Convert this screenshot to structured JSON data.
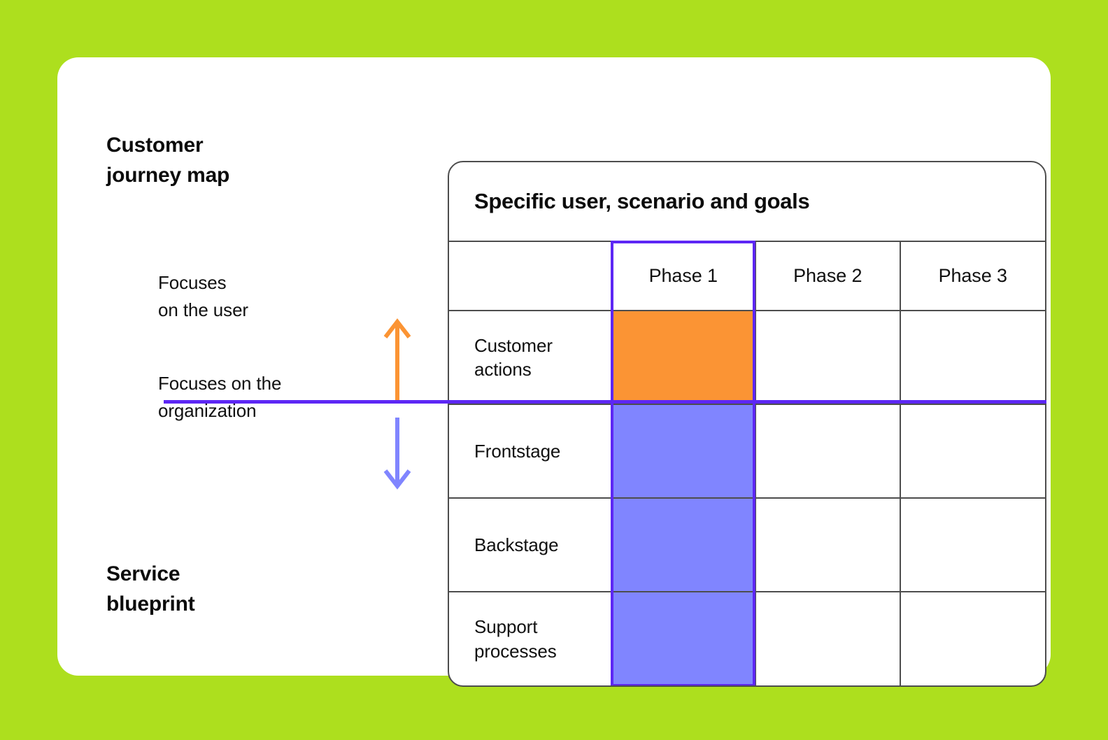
{
  "theme": {
    "background_green": "#ADDF1E",
    "card_white": "#FFFFFF",
    "accent_purple": "#5D27F5",
    "fill_purple": "#8085FF",
    "fill_orange": "#FB9434",
    "grid_gray": "#4D4D4D"
  },
  "left_panel": {
    "title_top": "Customer\njourney map",
    "title_bottom": "Service\nblueprint",
    "focus_user": "Focuses\non the user",
    "focus_org": "Focuses on the\norganization",
    "arrow_up_icon": "arrow-up-icon",
    "arrow_down_icon": "arrow-down-icon"
  },
  "table": {
    "header_title": "Specific user, scenario and goals",
    "corner_label": "",
    "columns": [
      "Phase 1",
      "Phase 2",
      "Phase 3"
    ],
    "rows": [
      {
        "label": "Customer\nactions",
        "cells": [
          "orange",
          "",
          ""
        ]
      },
      {
        "label": "Frontstage",
        "cells": [
          "purple",
          "",
          ""
        ]
      },
      {
        "label": "Backstage",
        "cells": [
          "purple",
          "",
          ""
        ]
      },
      {
        "label": "Support\nprocesses",
        "cells": [
          "purple",
          "",
          ""
        ]
      }
    ],
    "highlighted_column": "Phase 1"
  }
}
